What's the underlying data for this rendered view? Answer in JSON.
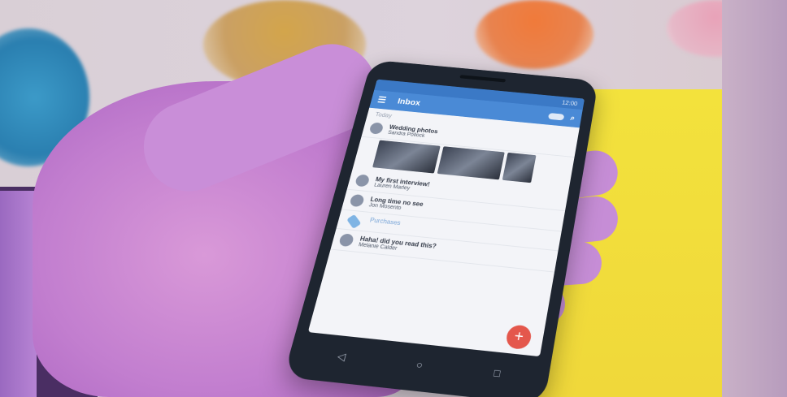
{
  "status_bar": {
    "time": "12:00"
  },
  "app_bar": {
    "title": "Inbox"
  },
  "section": {
    "label": "Today"
  },
  "items": [
    {
      "title": "Wedding photos",
      "sender": "Sandra Pollock",
      "snippet": "",
      "time": ""
    },
    {
      "title": "My first interview!",
      "sender": "Lauren Marley",
      "snippet": "",
      "time": ""
    },
    {
      "title": "Long time no see",
      "sender": "Jon Mosento",
      "snippet": "",
      "time": ""
    },
    {
      "title": "Purchases",
      "sender": "",
      "snippet": "",
      "time": ""
    },
    {
      "title": "Haha! did you read this?",
      "sender": "Melanie Calder",
      "snippet": "",
      "time": ""
    }
  ],
  "fab": {
    "label": "+"
  },
  "nav": {
    "back": "◁",
    "home": "○",
    "recents": "□"
  },
  "colors": {
    "app_bar": "#4a8ad6",
    "fab": "#e4574c",
    "background_yellow": "#f3e23c"
  }
}
